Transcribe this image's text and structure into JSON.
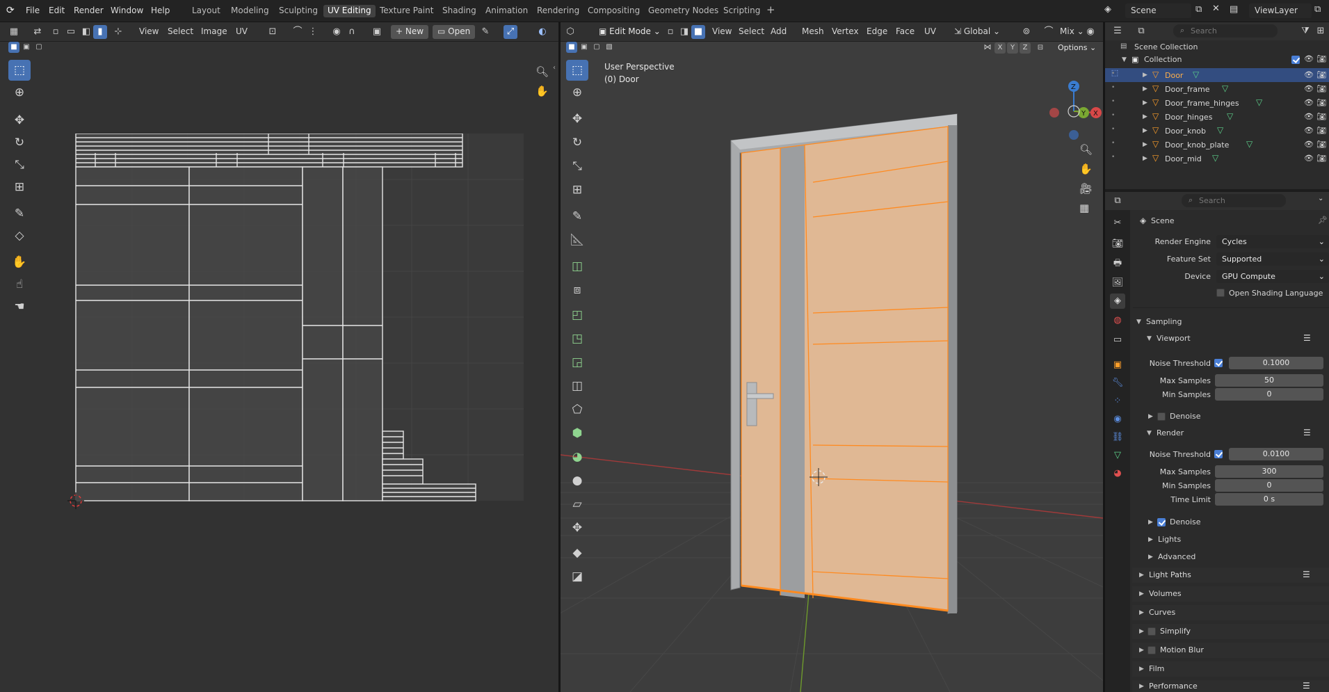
{
  "topbar": {
    "menus": [
      "File",
      "Edit",
      "Render",
      "Window",
      "Help"
    ],
    "workspaces": [
      "Layout",
      "Modeling",
      "Sculpting",
      "UV Editing",
      "Texture Paint",
      "Shading",
      "Animation",
      "Rendering",
      "Compositing",
      "Geometry Nodes",
      "Scripting"
    ],
    "active_workspace": "UV Editing",
    "scene_name": "Scene",
    "viewlayer_name": "ViewLayer"
  },
  "uv_editor": {
    "menus": [
      "View",
      "Select",
      "Image",
      "UV"
    ],
    "new_label": "New",
    "open_label": "Open"
  },
  "viewport": {
    "mode_label": "Edit Mode",
    "menus": [
      "View",
      "Select",
      "Add",
      "Mesh",
      "Vertex",
      "Edge",
      "Face",
      "UV"
    ],
    "orientation": "Global",
    "shading_mix": "Mix",
    "options_label": "Options",
    "axis_lock": [
      "X",
      "Y",
      "Z"
    ],
    "overlay_line1": "User Perspective",
    "overlay_line2": "(0) Door",
    "gizmo_labels": {
      "z": "Z",
      "y": "Y",
      "x": "X"
    }
  },
  "outliner": {
    "search_placeholder": "Search",
    "scene_collection": "Scene Collection",
    "collection": "Collection",
    "items": [
      {
        "name": "Door",
        "selected": true
      },
      {
        "name": "Door_frame",
        "selected": false
      },
      {
        "name": "Door_frame_hinges",
        "selected": false
      },
      {
        "name": "Door_hinges",
        "selected": false
      },
      {
        "name": "Door_knob",
        "selected": false
      },
      {
        "name": "Door_knob_plate",
        "selected": false
      },
      {
        "name": "Door_mid",
        "selected": false
      }
    ]
  },
  "properties": {
    "search_placeholder": "Search",
    "context_title": "Scene",
    "render_engine_label": "Render Engine",
    "render_engine": "Cycles",
    "feature_set_label": "Feature Set",
    "feature_set": "Supported",
    "device_label": "Device",
    "device": "GPU Compute",
    "osl_label": "Open Shading Language",
    "sampling": "Sampling",
    "viewport": {
      "title": "Viewport",
      "noise_threshold_label": "Noise Threshold",
      "noise_threshold": "0.1000",
      "max_samples_label": "Max Samples",
      "max_samples": "50",
      "min_samples_label": "Min Samples",
      "min_samples": "0",
      "denoise_label": "Denoise"
    },
    "render": {
      "title": "Render",
      "noise_threshold_label": "Noise Threshold",
      "noise_threshold": "0.0100",
      "max_samples_label": "Max Samples",
      "max_samples": "300",
      "min_samples_label": "Min Samples",
      "min_samples": "0",
      "time_limit_label": "Time Limit",
      "time_limit": "0 s",
      "denoise_label": "Denoise"
    },
    "lights": "Lights",
    "advanced": "Advanced",
    "sections": [
      "Light Paths",
      "Volumes",
      "Curves",
      "Simplify",
      "Motion Blur",
      "Film",
      "Performance"
    ]
  },
  "colors": {
    "accent_blue": "#4772b3",
    "edit_orange": "#ff8a1f",
    "mesh_face": "#e0b894",
    "frame_gray": "#a8aaac"
  }
}
